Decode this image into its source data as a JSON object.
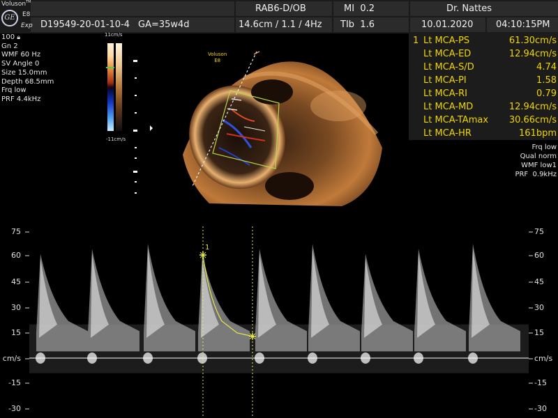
{
  "header": {
    "brand_line1": "Voluson",
    "brand_superscript": "TM",
    "logo_text": "GE",
    "brand_e": "E8",
    "brand_exp": "Exp",
    "patient_id": "D19549-20-01-10-4",
    "ga": "GA=35w4d",
    "probe": "RAB6-D/OB",
    "scan_params": "14.6cm / 1.1 / 4Hz",
    "mi": "MI  0.2",
    "tib": "TIb  1.6",
    "doctor": "Dr. Nattes",
    "date": "10.01.2020",
    "time": "04:10:15PM"
  },
  "left_params": [
    "100",
    "Gn  2",
    "WMF 60 Hz",
    "SV Angle  0",
    "Size 15.0mm",
    "Depth 68.5mm",
    "Frq low",
    "PRF  4.4kHz"
  ],
  "colorbar": {
    "top_label": "11cm/s",
    "bottom_label": "-11cm/s"
  },
  "image_watermark": {
    "line1": "Voluson",
    "line2": "E8"
  },
  "measurements": [
    {
      "num": "1",
      "label": "Lt MCA-PS",
      "value": "61.30cm/s"
    },
    {
      "num": "",
      "label": "Lt MCA-ED",
      "value": "12.94cm/s"
    },
    {
      "num": "",
      "label": "Lt MCA-S/D",
      "value": "4.74"
    },
    {
      "num": "",
      "label": "Lt MCA-PI",
      "value": "1.58"
    },
    {
      "num": "",
      "label": "Lt MCA-RI",
      "value": "0.79"
    },
    {
      "num": "",
      "label": "Lt MCA-MD",
      "value": "12.94cm/s"
    },
    {
      "num": "",
      "label": "Lt MCA-TAmax",
      "value": "30.66cm/s"
    },
    {
      "num": "",
      "label": "Lt MCA-HR",
      "value": "161bpm"
    }
  ],
  "right_settings": [
    "Frq low",
    "Qual norm",
    "WMF low1",
    "PRF  0.9kHz"
  ],
  "doppler": {
    "ticks": [
      "75",
      "60",
      "45",
      "30",
      "15",
      "cm/s",
      "-15",
      "-30"
    ],
    "marker_label": "1"
  },
  "colors": {
    "measurement_text": "#f2d600",
    "caliper": "#e8e850",
    "colorbox": "#b8d84a",
    "baseline": "#ffffff"
  }
}
